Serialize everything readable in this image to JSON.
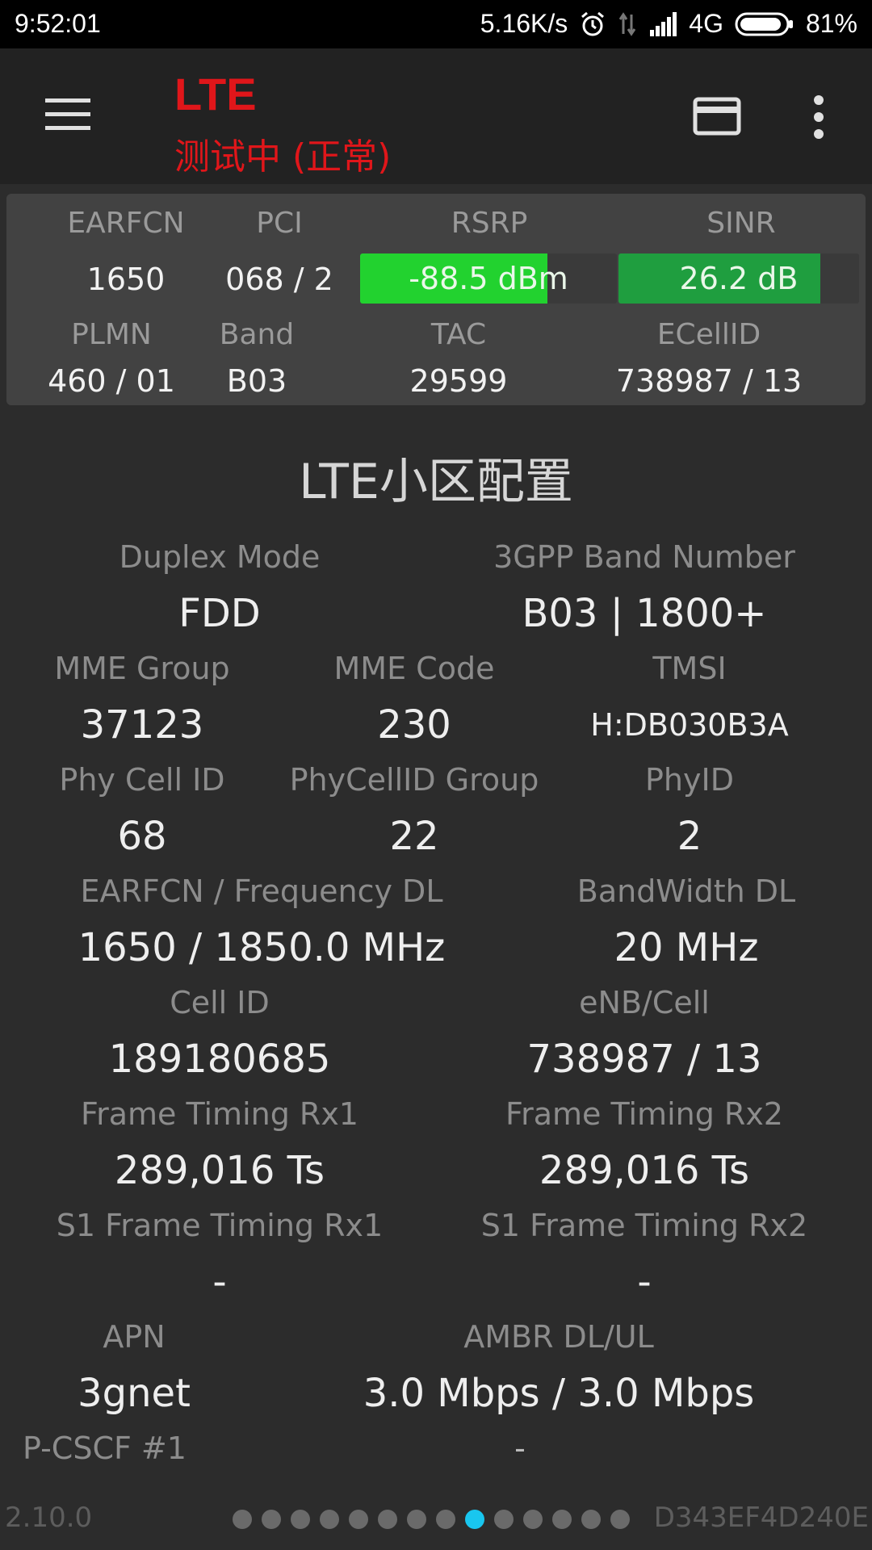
{
  "status_bar": {
    "time": "9:52:01",
    "net_speed": "5.16K/s",
    "network": "4G",
    "battery": "81%",
    "icons": [
      "alarm-icon",
      "data-transfer-icon",
      "signal-icon",
      "battery-icon"
    ]
  },
  "app_bar": {
    "title": "LTE",
    "subtitle": "测试中 (正常)",
    "accent_color": "#e0161a",
    "icons": [
      "menu-icon",
      "sim-card-icon",
      "more-vert-icon"
    ]
  },
  "summary": {
    "earfcn": {
      "label": "EARFCN",
      "value": "1650"
    },
    "pci": {
      "label": "PCI",
      "value": "068 / 2"
    },
    "rsrp": {
      "label": "RSRP",
      "value": "-88.5 dBm",
      "level": 0.73,
      "color": "#22d22f"
    },
    "sinr": {
      "label": "SINR",
      "value": "26.2 dB",
      "level": 0.84,
      "color": "#1f9e3f"
    },
    "plmn": {
      "label": "PLMN",
      "value": "460 / 01"
    },
    "band": {
      "label": "Band",
      "value": "B03"
    },
    "tac": {
      "label": "TAC",
      "value": "29599"
    },
    "ecellid": {
      "label": "ECellID",
      "value": "738987 / 13"
    }
  },
  "section": {
    "title": "LTE小区配置",
    "fields": {
      "duplex_mode": {
        "label": "Duplex Mode",
        "value": "FDD"
      },
      "band_number": {
        "label": "3GPP Band Number",
        "value": "B03 | 1800+"
      },
      "mme_group": {
        "label": "MME Group",
        "value": "37123"
      },
      "mme_code": {
        "label": "MME Code",
        "value": "230"
      },
      "tmsi": {
        "label": "TMSI",
        "value": "H:DB030B3A"
      },
      "phy_cell_id": {
        "label": "Phy Cell ID",
        "value": "68"
      },
      "phycellid_group": {
        "label": "PhyCellID Group",
        "value": "22"
      },
      "phyid": {
        "label": "PhyID",
        "value": "2"
      },
      "earfcn_freq_dl": {
        "label": "EARFCN / Frequency DL",
        "value": "1650 / 1850.0 MHz"
      },
      "bandwidth_dl": {
        "label": "BandWidth DL",
        "value": "20 MHz"
      },
      "cell_id": {
        "label": "Cell ID",
        "value": "189180685"
      },
      "enb_cell": {
        "label": "eNB/Cell",
        "value": "738987 / 13"
      },
      "frame_timing_rx1": {
        "label": "Frame Timing Rx1",
        "value": "289,016 Ts"
      },
      "frame_timing_rx2": {
        "label": "Frame Timing Rx2",
        "value": "289,016 Ts"
      },
      "s1_frame_timing_rx1": {
        "label": "S1 Frame Timing Rx1",
        "value": "-"
      },
      "s1_frame_timing_rx2": {
        "label": "S1 Frame Timing Rx2",
        "value": "-"
      },
      "apn": {
        "label": "APN",
        "value": "3gnet"
      },
      "ambr": {
        "label": "AMBR DL/UL",
        "value": "3.0 Mbps / 3.0 Mbps"
      },
      "pcscf1": {
        "label": "P-CSCF #1",
        "value": "-"
      }
    }
  },
  "footer": {
    "version": "2.10.0",
    "device_id": "D343EF4D240E",
    "page_count": 14,
    "active_page": 9,
    "active_color": "#19c6ef"
  }
}
